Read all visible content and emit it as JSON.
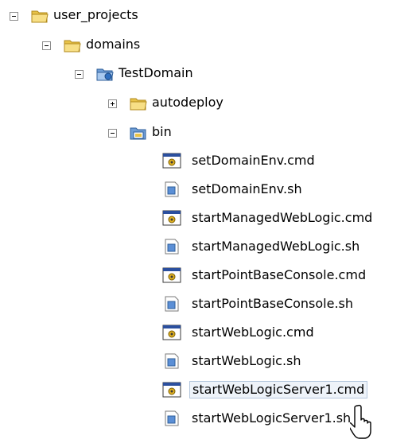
{
  "tree": {
    "nodes": [
      {
        "label": "user_projects",
        "icon": "folder-open-icon",
        "toggle": "minus"
      },
      {
        "label": "domains",
        "icon": "folder-open-icon",
        "toggle": "minus"
      },
      {
        "label": "TestDomain",
        "icon": "domain-folder-icon",
        "toggle": "minus"
      },
      {
        "label": "autodeploy",
        "icon": "folder-icon",
        "toggle": "plus"
      },
      {
        "label": "bin",
        "icon": "bin-folder-icon",
        "toggle": "minus"
      }
    ],
    "files": [
      {
        "label": "setDomainEnv.cmd",
        "icon": "cmd-file-icon"
      },
      {
        "label": "setDomainEnv.sh",
        "icon": "sh-file-icon"
      },
      {
        "label": "startManagedWebLogic.cmd",
        "icon": "cmd-file-icon"
      },
      {
        "label": "startManagedWebLogic.sh",
        "icon": "sh-file-icon"
      },
      {
        "label": "startPointBaseConsole.cmd",
        "icon": "cmd-file-icon"
      },
      {
        "label": "startPointBaseConsole.sh",
        "icon": "sh-file-icon"
      },
      {
        "label": "startWebLogic.cmd",
        "icon": "cmd-file-icon"
      },
      {
        "label": "startWebLogic.sh",
        "icon": "sh-file-icon"
      },
      {
        "label": "startWebLogicServer1.cmd",
        "icon": "cmd-file-icon",
        "selected": true
      },
      {
        "label": "startWebLogicServer1.sh",
        "icon": "sh-file-icon"
      }
    ]
  }
}
